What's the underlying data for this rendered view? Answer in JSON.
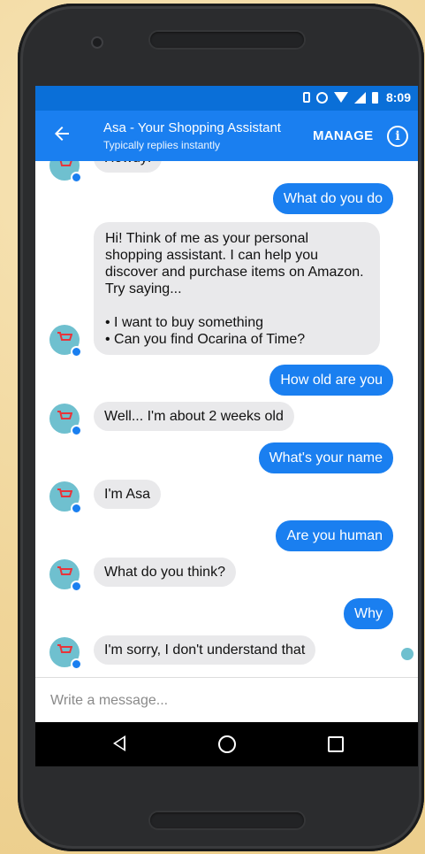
{
  "status_bar": {
    "time": "8:09"
  },
  "app_bar": {
    "title": "Asa - Your Shopping Assistant",
    "subtitle": "Typically replies instantly",
    "manage_label": "MANAGE",
    "info_icon": "i"
  },
  "messages": [
    {
      "from": "bot",
      "text": "Howdy!"
    },
    {
      "from": "user",
      "text": "What do you do"
    },
    {
      "from": "bot",
      "text": "Hi! Think of me as your personal shopping assistant. I can help you discover and purchase items on Amazon. Try saying...\n\n• I want to buy something\n• Can you find Ocarina of Time?"
    },
    {
      "from": "user",
      "text": "How old are you"
    },
    {
      "from": "bot",
      "text": "Well... I'm about 2 weeks old"
    },
    {
      "from": "user",
      "text": "What's your name"
    },
    {
      "from": "bot",
      "text": "I'm Asa"
    },
    {
      "from": "user",
      "text": "Are you human"
    },
    {
      "from": "bot",
      "text": "What do you think?"
    },
    {
      "from": "user",
      "text": "Why"
    },
    {
      "from": "bot",
      "text": "I'm sorry, I don't understand that"
    }
  ],
  "composer": {
    "placeholder": "Write a message..."
  },
  "colors": {
    "primary": "#1a7ff0",
    "status_bar": "#0a6fd8",
    "bot_bubble": "#e9e9eb",
    "avatar": "#6fc0cf"
  }
}
